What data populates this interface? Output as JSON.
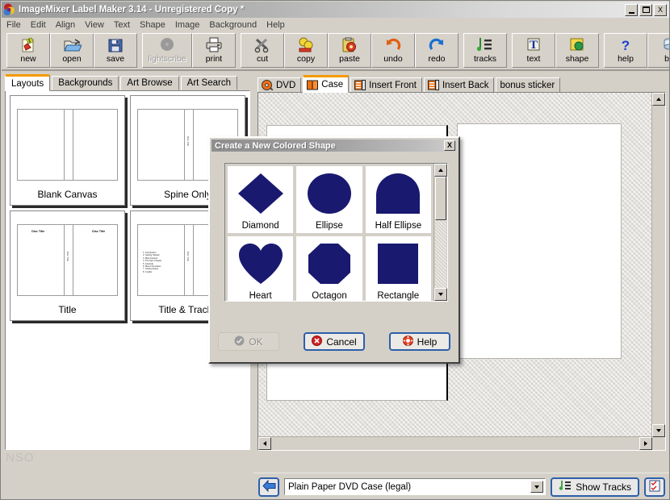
{
  "window": {
    "title": "ImageMixer Label Maker 3.14 - Unregistered Copy *",
    "minimize_label": "",
    "maximize_label": "",
    "close_label": "X"
  },
  "menubar": {
    "items": [
      {
        "label": "File"
      },
      {
        "label": "Edit"
      },
      {
        "label": "Align"
      },
      {
        "label": "View"
      },
      {
        "label": "Text"
      },
      {
        "label": "Shape"
      },
      {
        "label": "Image"
      },
      {
        "label": "Background"
      },
      {
        "label": "Help"
      }
    ]
  },
  "toolbar": {
    "buttons": [
      {
        "label": "new",
        "icon": "new-document-icon",
        "enabled": true
      },
      {
        "label": "open",
        "icon": "open-folder-icon",
        "enabled": true
      },
      {
        "label": "save",
        "icon": "floppy-disk-icon",
        "enabled": true
      },
      {
        "label": "lightscribe",
        "icon": "lightscribe-disc-icon",
        "enabled": false
      },
      {
        "label": "print",
        "icon": "printer-icon",
        "enabled": true
      },
      {
        "label": "cut",
        "icon": "scissors-icon",
        "enabled": true
      },
      {
        "label": "copy",
        "icon": "copy-icon",
        "enabled": true
      },
      {
        "label": "paste",
        "icon": "paste-icon",
        "enabled": true
      },
      {
        "label": "undo",
        "icon": "undo-arrow-icon",
        "enabled": true
      },
      {
        "label": "redo",
        "icon": "redo-arrow-icon",
        "enabled": true
      },
      {
        "label": "tracks",
        "icon": "tracks-list-icon",
        "enabled": true
      },
      {
        "label": "text",
        "icon": "text-tool-icon",
        "enabled": true
      },
      {
        "label": "shape",
        "icon": "shape-tool-icon",
        "enabled": true
      },
      {
        "label": "help",
        "icon": "question-mark-icon",
        "enabled": true
      },
      {
        "label": "bu",
        "icon": "burn-disc-icon",
        "enabled": true
      }
    ]
  },
  "left_panel": {
    "tabs": [
      {
        "label": "Layouts",
        "active": true
      },
      {
        "label": "Backgrounds",
        "active": false
      },
      {
        "label": "Art Browse",
        "active": false
      },
      {
        "label": "Art Search",
        "active": false
      }
    ],
    "layouts": [
      {
        "name": "Blank Canvas",
        "disc_title": "",
        "has_tracks": false,
        "spine_text": ""
      },
      {
        "name": "Spine Only",
        "disc_title": "",
        "has_tracks": false,
        "spine_text": "Disc Title"
      },
      {
        "name": "Title",
        "disc_title": "Disc Title",
        "has_tracks": false,
        "spine_text": "Disc Title"
      },
      {
        "name": "Title & Tracks",
        "disc_title": "Disc Title",
        "has_tracks": true,
        "spine_text": "Disc Title"
      }
    ],
    "track_sample": [
      "1. Introduction",
      "2. Getting Started",
      "3. Main Feature",
      "4. The Next Chapter",
      "5. Interlude",
      "6. More Information",
      "7. Closing Notes",
      "8. Credits"
    ],
    "watermark": "NSO"
  },
  "main_panel": {
    "tabs": [
      {
        "label": "DVD",
        "icon": "disc-icon",
        "active": false
      },
      {
        "label": "Case",
        "icon": "case-icon",
        "active": true
      },
      {
        "label": "Insert Front",
        "icon": "insert-front-icon",
        "active": false
      },
      {
        "label": "Insert Back",
        "icon": "insert-back-icon",
        "active": false
      },
      {
        "label": "bonus sticker",
        "icon": "",
        "active": false
      }
    ]
  },
  "bottom_bar": {
    "back_icon": "blue-left-arrow-icon",
    "paper_select_value": "Plain Paper DVD Case (legal)",
    "paper_select_options": [
      "Plain Paper DVD Case (legal)"
    ],
    "show_tracks_label": "Show Tracks",
    "show_tracks_icon": "tracks-list-icon",
    "checklist_icon": "checklist-icon"
  },
  "dialog": {
    "title": "Create a New Colored Shape",
    "close_label": "X",
    "shape_color": "#191970",
    "shapes": [
      {
        "name": "Diamond",
        "glyph": "diamond"
      },
      {
        "name": "Ellipse",
        "glyph": "ellipse"
      },
      {
        "name": "Half Ellipse",
        "glyph": "half-ellipse"
      },
      {
        "name": "Heart",
        "glyph": "heart"
      },
      {
        "name": "Octagon",
        "glyph": "octagon"
      },
      {
        "name": "Rectangle",
        "glyph": "rectangle"
      }
    ],
    "buttons": {
      "ok": {
        "label": "OK",
        "enabled": false,
        "icon": "ok-check-icon"
      },
      "cancel": {
        "label": "Cancel",
        "enabled": true,
        "icon": "cancel-x-icon"
      },
      "help": {
        "label": "Help",
        "enabled": true,
        "icon": "lifering-help-icon"
      }
    }
  }
}
